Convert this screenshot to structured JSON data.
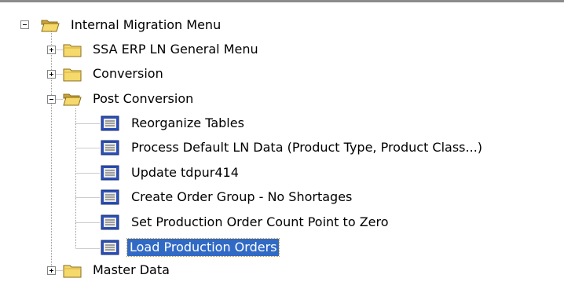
{
  "tree": {
    "root": {
      "label": "Internal Migration Menu",
      "icon": "folder-open-icon",
      "expander": "minus"
    },
    "children": [
      {
        "label": "SSA ERP LN General Menu",
        "icon": "folder-closed-icon",
        "expander": "plus"
      },
      {
        "label": "Conversion",
        "icon": "folder-closed-icon",
        "expander": "plus"
      },
      {
        "label": "Post Conversion",
        "icon": "folder-open-icon",
        "expander": "minus",
        "items": [
          {
            "label": "Reorganize Tables",
            "icon": "session-icon"
          },
          {
            "label": "Process Default LN Data (Product Type, Product Class...)",
            "icon": "session-icon"
          },
          {
            "label": "Update tdpur414",
            "icon": "session-icon"
          },
          {
            "label": "Create Order Group - No Shortages",
            "icon": "session-icon"
          },
          {
            "label": "Set Production Order Count Point to Zero",
            "icon": "session-icon"
          },
          {
            "label": "Load Production Orders",
            "icon": "session-icon",
            "selected": true
          }
        ]
      },
      {
        "label": "Master Data",
        "icon": "folder-closed-icon",
        "expander": "plus"
      }
    ]
  },
  "colors": {
    "selection": "#316ac5",
    "folder": "#f5d96a",
    "session_icon_fill": "#2a4fb8"
  }
}
